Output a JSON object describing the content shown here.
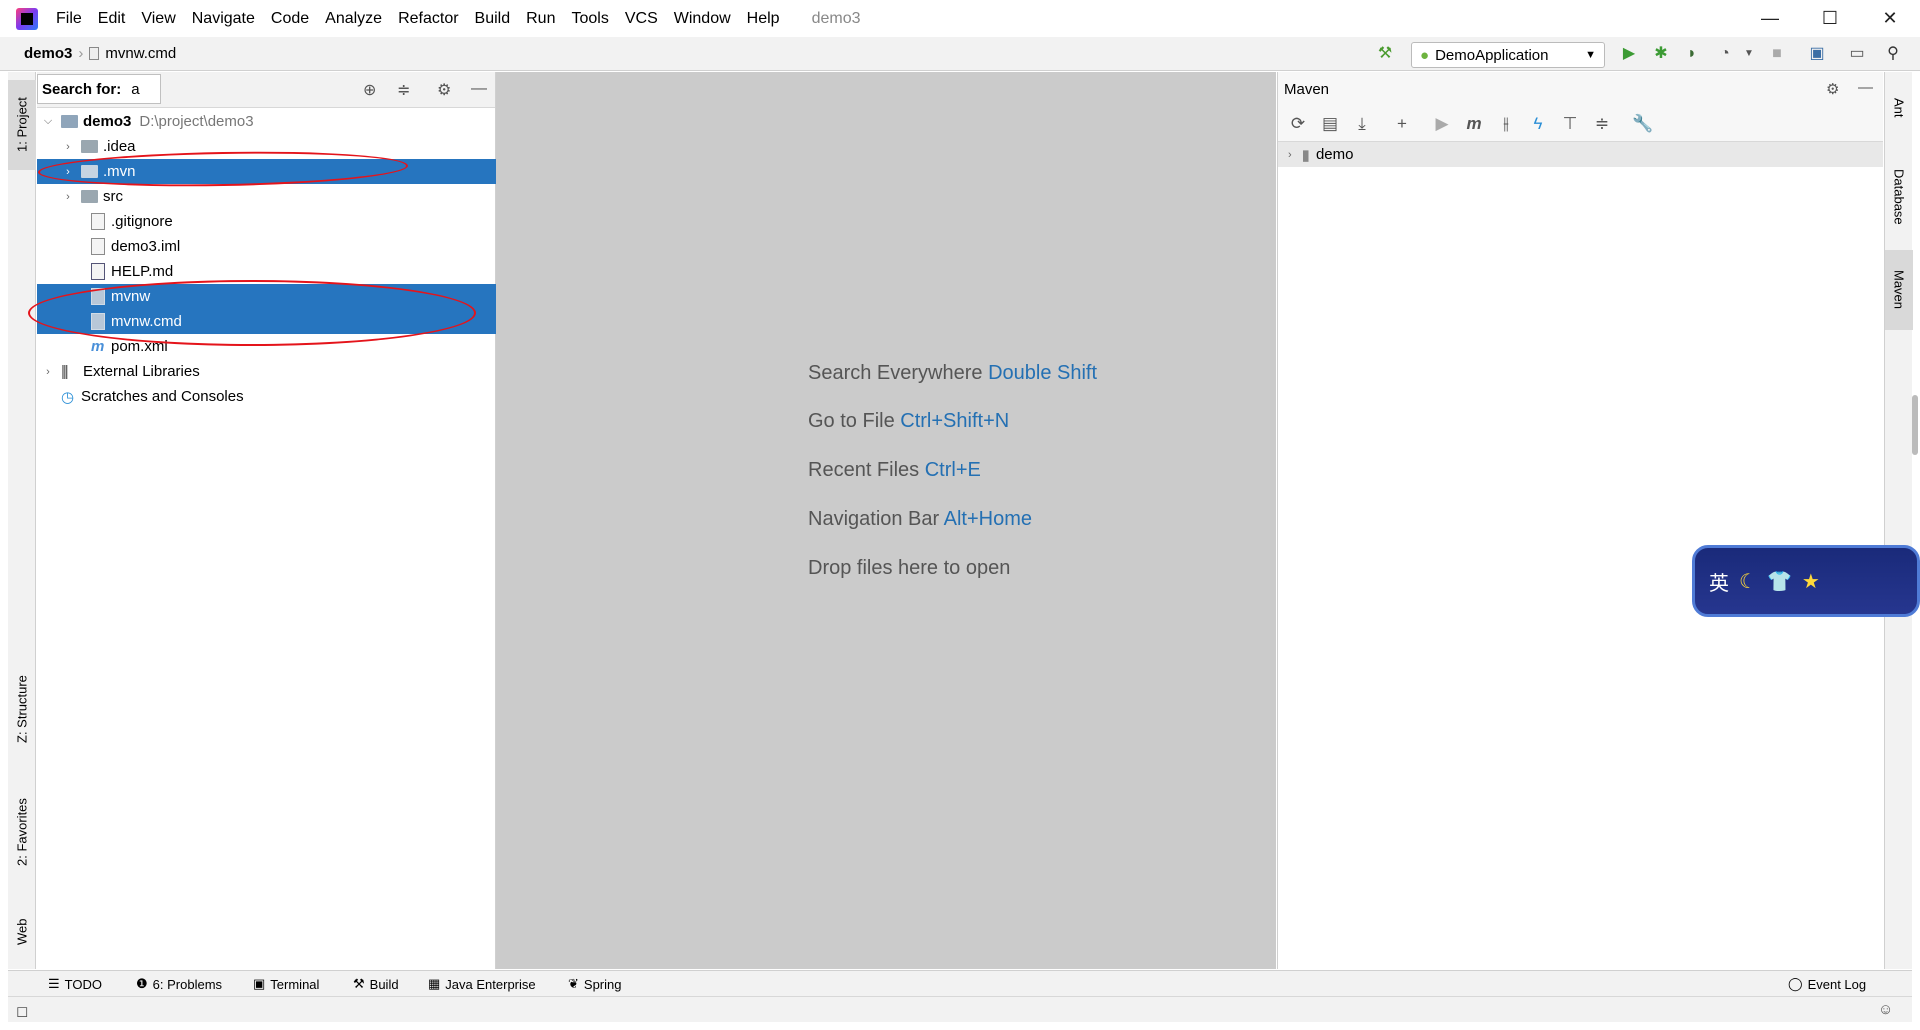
{
  "menu": [
    "File",
    "Edit",
    "View",
    "Navigate",
    "Code",
    "Analyze",
    "Refactor",
    "Build",
    "Run",
    "Tools",
    "VCS",
    "Window",
    "Help"
  ],
  "window_title": "demo3",
  "window_controls": {
    "minimize": "—",
    "maximize": "☐",
    "close": "✕"
  },
  "breadcrumb": {
    "project": "demo3",
    "file": "mvnw.cmd"
  },
  "run_config": "DemoApplication",
  "project_panel": {
    "search_label": "Search for:",
    "search_query": "a",
    "root_name": "demo3",
    "root_path": "D:\\project\\demo3",
    "items": [
      {
        "label": ".idea",
        "selected": false
      },
      {
        "label": ".mvn",
        "selected": true
      },
      {
        "label": "src",
        "selected": false
      },
      {
        "label": ".gitignore",
        "selected": false
      },
      {
        "label": "demo3.iml",
        "selected": false
      },
      {
        "label": "HELP.md",
        "selected": false
      },
      {
        "label": "mvnw",
        "selected": true
      },
      {
        "label": "mvnw.cmd",
        "selected": true
      },
      {
        "label": "pom.xml",
        "selected": false
      }
    ],
    "external_libraries": "External Libraries",
    "scratches": "Scratches and Consoles"
  },
  "left_tabs": {
    "project": "1: Project",
    "structure": "Z: Structure",
    "favorites": "2: Favorites",
    "web": "Web"
  },
  "right_tabs": {
    "ant": "Ant",
    "database": "Database",
    "maven": "Maven"
  },
  "editor_hints": [
    {
      "text": "Search Everywhere",
      "shortcut": "Double Shift"
    },
    {
      "text": "Go to File",
      "shortcut": "Ctrl+Shift+N"
    },
    {
      "text": "Recent Files",
      "shortcut": "Ctrl+E"
    },
    {
      "text": "Navigation Bar",
      "shortcut": "Alt+Home"
    },
    {
      "text": "Drop files here to open",
      "shortcut": ""
    }
  ],
  "maven_panel": {
    "title": "Maven",
    "project": "demo"
  },
  "bottom_tabs": [
    "TODO",
    "6: Problems",
    "Terminal",
    "Build",
    "Java Enterprise",
    "Spring"
  ],
  "event_log": "Event Log",
  "ime_badge": "英",
  "colors": {
    "selection": "#2675bf",
    "hint_shortcut": "#2470b3",
    "annotation": "#e4141b"
  }
}
